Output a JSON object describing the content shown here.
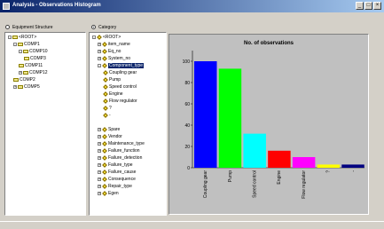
{
  "window": {
    "title": "Analysis - Observations Histogram"
  },
  "left_panel": {
    "radio_label": "Equipment Structure",
    "items": [
      {
        "label": "<ROOT>",
        "depth": 0,
        "exp": "-",
        "icon": "folder"
      },
      {
        "label": "COMP1",
        "depth": 1,
        "exp": "-",
        "icon": "folder"
      },
      {
        "label": "COMP10",
        "depth": 2,
        "exp": "-",
        "icon": "folder"
      },
      {
        "label": "COMP3",
        "depth": 3,
        "exp": "",
        "icon": "folder"
      },
      {
        "label": "COMP11",
        "depth": 2,
        "exp": "",
        "icon": "folder"
      },
      {
        "label": "COMP12",
        "depth": 2,
        "exp": "+",
        "icon": "folder"
      },
      {
        "label": "COMP2",
        "depth": 1,
        "exp": "",
        "icon": "folder"
      },
      {
        "label": "COMP5",
        "depth": 1,
        "exp": "+",
        "icon": "folder"
      }
    ]
  },
  "mid_panel": {
    "radio_label": "Category",
    "items": [
      {
        "label": "<ROOT>",
        "depth": 0,
        "exp": "-",
        "selected": false
      },
      {
        "label": "item_name",
        "depth": 1,
        "exp": "+",
        "selected": false
      },
      {
        "label": "Eq_no",
        "depth": 1,
        "exp": "+",
        "selected": false
      },
      {
        "label": "System_no",
        "depth": 1,
        "exp": "+",
        "selected": false
      },
      {
        "label": "Component_type",
        "depth": 1,
        "exp": "-",
        "selected": true
      },
      {
        "label": "Coupling gear",
        "depth": 2,
        "exp": "",
        "selected": false
      },
      {
        "label": "Pump",
        "depth": 2,
        "exp": "",
        "selected": false
      },
      {
        "label": "Speed control",
        "depth": 2,
        "exp": "",
        "selected": false
      },
      {
        "label": "Engine",
        "depth": 2,
        "exp": "",
        "selected": false
      },
      {
        "label": "Flow regulator",
        "depth": 2,
        "exp": "",
        "selected": false
      },
      {
        "label": "?",
        "depth": 2,
        "exp": "",
        "selected": false
      },
      {
        "label": "-",
        "depth": 2,
        "exp": "",
        "selected": false
      },
      {
        "label": "",
        "depth": 0,
        "exp": "",
        "selected": false
      },
      {
        "label": "Spare",
        "depth": 1,
        "exp": "+",
        "selected": false
      },
      {
        "label": "Vendor",
        "depth": 1,
        "exp": "+",
        "selected": false
      },
      {
        "label": "Maintenance_type",
        "depth": 1,
        "exp": "+",
        "selected": false
      },
      {
        "label": "Failure_function",
        "depth": 1,
        "exp": "+",
        "selected": false
      },
      {
        "label": "Failure_detection",
        "depth": 1,
        "exp": "+",
        "selected": false
      },
      {
        "label": "Failure_type",
        "depth": 1,
        "exp": "+",
        "selected": false
      },
      {
        "label": "Failure_cause",
        "depth": 1,
        "exp": "+",
        "selected": false
      },
      {
        "label": "Consequence",
        "depth": 1,
        "exp": "+",
        "selected": false
      },
      {
        "label": "Repair_type",
        "depth": 1,
        "exp": "+",
        "selected": false
      },
      {
        "label": "Egen",
        "depth": 1,
        "exp": "+",
        "selected": false
      }
    ]
  },
  "chart_data": {
    "type": "bar",
    "title": "No. of observations",
    "xlabel": "",
    "ylabel": "",
    "categories": [
      "Coupling gear",
      "Pump",
      "Speed control",
      "Engine",
      "Flow regulator",
      "?",
      "-"
    ],
    "values": [
      100,
      93,
      32,
      16,
      10,
      3,
      3
    ],
    "colors": [
      "#0000ff",
      "#00ff00",
      "#00ffff",
      "#ff0000",
      "#ff00ff",
      "#ffff00",
      "#000080"
    ],
    "ylim": [
      0,
      110
    ],
    "yticks": [
      0,
      20,
      40,
      60,
      80,
      100
    ],
    "grid": false,
    "background": "#c0c0c0"
  }
}
